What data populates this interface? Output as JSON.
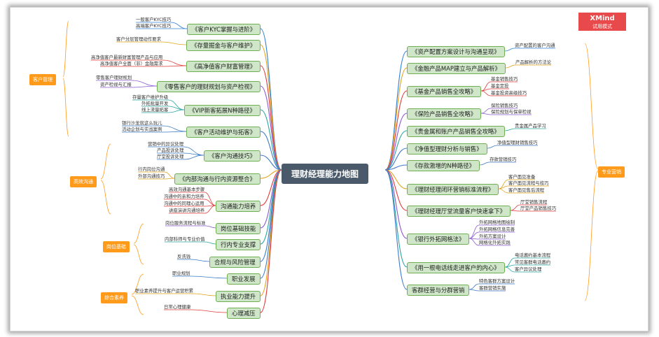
{
  "badge": {
    "title": "XMind",
    "subtitle": "试用模式"
  },
  "root": "理财经理能力地图",
  "categories": {
    "left1": "客户管理",
    "left2": "高效沟通",
    "left3": "岗位基础",
    "left4": "综合素养",
    "right": "专业营销"
  },
  "left_branches": [
    {
      "label": "《客户KYC掌握与进阶》",
      "leaves": [
        "一般客户KYC技巧",
        "高端客户KYC技巧"
      ]
    },
    {
      "label": "《存量掘金与客户维护》",
      "leaves": [
        "客户分层管理动作要求"
      ]
    },
    {
      "label": "《高净值客户财富管理》",
      "leaves": [
        "高净值客户最新财富管理产品与应用",
        "高净值客户全面（非）金融需求"
      ]
    },
    {
      "label": "《零售客户的理财规划与资产检视》",
      "leaves": [
        "零售客户理财规划",
        "资产检视与汇报"
      ]
    },
    {
      "label": "《VIP新客拓展N种路径》",
      "leaves": [
        "存量客户维护升级",
        "外拓批量开发",
        "线上流量拓客"
      ]
    },
    {
      "label": "《客户活动维护与拓客》",
      "leaves": [
        "银行沙龙就这么玩儿",
        "活动企划与实战案例"
      ]
    },
    {
      "label": "《客户沟通技巧》",
      "leaves": [
        "营销中的异议处理",
        "产品投诉处理",
        "厅堂投诉处理"
      ]
    },
    {
      "label": "《内部沟通与行内资源整合》",
      "leaves": [
        "行内岗位沟通",
        "外部沟通技巧"
      ]
    },
    {
      "label": "沟通能力培养",
      "leaves": [
        "高效沟通基本步骤",
        "沟通中的亲和力培养",
        "沟通中的同理心运用",
        "讲座演讲沟通培养"
      ]
    },
    {
      "label": "岗位基础技能",
      "leaves": [
        "岗位服务流程与标准"
      ]
    },
    {
      "label": "行内专业支撑",
      "leaves": [
        "内部科师与专业价值"
      ]
    },
    {
      "label": "合规与风险管理",
      "leaves": [
        "反洗钱"
      ]
    },
    {
      "label": "职业发展",
      "leaves": [
        "职业规划"
      ]
    },
    {
      "label": "执业能力提升",
      "leaves": [
        "职业素养提升与客户运营积累"
      ]
    },
    {
      "label": "心理减压",
      "leaves": [
        "日常心理健康"
      ]
    }
  ],
  "right_branches": [
    {
      "label": "《资产配置方案设计与沟通呈现》",
      "leaves": [
        "资产配置的客户沟通"
      ]
    },
    {
      "label": "《金融产品MAP建立与产品解析》",
      "leaves": [
        "产品解析的方法论"
      ]
    },
    {
      "label": "《基金产品销售全攻略》",
      "leaves": [
        "基金销售技巧",
        "基金定投",
        "基金投资高级技巧"
      ]
    },
    {
      "label": "《保险产品销售全攻略》",
      "leaves": [
        "保险销售技巧",
        "保险规划与保单检视"
      ]
    },
    {
      "label": "《贵金属和账户产品销售全攻略》",
      "leaves": [
        "贵金属产品学习"
      ]
    },
    {
      "label": "《净值型理财分析与销售》",
      "leaves": [
        "净值型理财销售技巧"
      ]
    },
    {
      "label": "《存款激增的N种路径》",
      "leaves": [
        "存款营销技巧"
      ]
    },
    {
      "label": "《理财经理闭环营销标准流程》",
      "leaves": [
        "客户面见准备",
        "客户面见流程与技巧",
        "客户面见售后流程"
      ]
    },
    {
      "label": "《理财经理厅堂流量客户快速拿下》",
      "leaves": [
        "厅堂销售流程",
        "厅堂产品销售技巧"
      ]
    },
    {
      "label": "《银行外拓网格法》",
      "leaves": [
        "外拓网格地图绘制",
        "外拓网格信息完善",
        "外拓方案设计",
        "网格化外拓实践"
      ]
    },
    {
      "label": "《用一根电话线走进客户的内心》",
      "leaves": [
        "电话邀约基本流程",
        "常见客群电话邀约",
        "客户异议处理"
      ]
    },
    {
      "label": "客群经营与分群营销",
      "leaves": [
        "特色客群方案设计",
        "客群营销实施"
      ]
    }
  ]
}
